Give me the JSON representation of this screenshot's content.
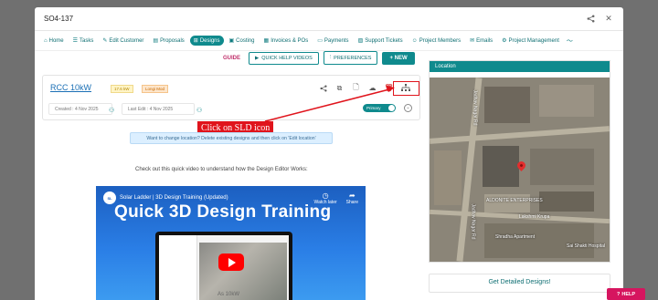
{
  "modal": {
    "title": "SO4-137"
  },
  "header_icons": [
    "share-icon",
    "close-icon"
  ],
  "nav": {
    "items": [
      {
        "label": "Home",
        "icon": "home-icon"
      },
      {
        "label": "Tasks",
        "icon": "tasks-icon"
      },
      {
        "label": "Edit Customer",
        "icon": "edit-icon"
      },
      {
        "label": "Proposals",
        "icon": "document-icon"
      },
      {
        "label": "Designs",
        "icon": "grid-icon",
        "active": true
      },
      {
        "label": "Costing",
        "icon": "cart-icon"
      },
      {
        "label": "Invoices & POs",
        "icon": "invoice-icon"
      },
      {
        "label": "Payments",
        "icon": "payment-icon"
      },
      {
        "label": "Support Tickets",
        "icon": "ticket-icon"
      },
      {
        "label": "Project Members",
        "icon": "people-icon"
      },
      {
        "label": "Emails",
        "icon": "mail-icon"
      },
      {
        "label": "Project Management",
        "icon": "pm-icon"
      }
    ]
  },
  "toolbar": {
    "guide": "GUIDE",
    "quick_help": "QUICK HELP VIDEOS",
    "preferences": "PREFERENCES",
    "new": "+ NEW"
  },
  "design": {
    "title": "RCC 10kW",
    "kw_badge": "17.6 kW",
    "module_badge": "Longi Mod",
    "created": "Created : 4 Nov 2025",
    "last_edit": "Last Edit : 4 Nov 2025",
    "primary_label": "Primary"
  },
  "annotation": {
    "callout": "Click on SLD icon"
  },
  "info_text": "Want to change location? Delete existing designs and then click on 'Edit location'",
  "video": {
    "caption": "Check out this quick video to understand how the Design Editor Works:",
    "channel": "Solar Ladder",
    "title_small": "Solar Ladder | 3D Design Training (Updated)",
    "title_big": "Quick 3D Design Training",
    "watch_later": "Watch later",
    "share": "Share",
    "below_text": "As 10kW"
  },
  "location": {
    "header": "Location",
    "labels": [
      "Jadhav Nagar Rd",
      "ALDONITE ENTERPRISES",
      "Lakshmi Krupa",
      "Jadhav Nagar Rd",
      "Shradha Apartment",
      "Sai Shakti Hospital"
    ]
  },
  "detailed_button": "Get Detailed Designs!",
  "help_button": "HELP"
}
